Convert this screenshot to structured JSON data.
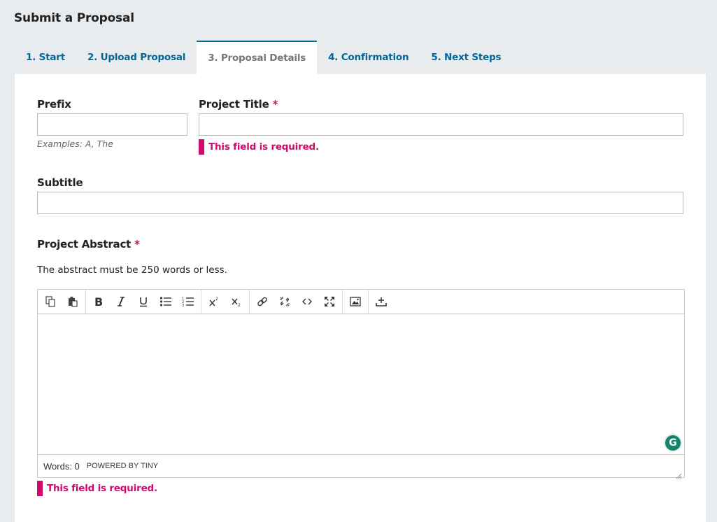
{
  "page": {
    "title": "Submit a Proposal"
  },
  "tabs": [
    {
      "label": "1. Start",
      "active": false
    },
    {
      "label": "2. Upload Proposal",
      "active": false
    },
    {
      "label": "3. Proposal Details",
      "active": true
    },
    {
      "label": "4. Confirmation",
      "active": false
    },
    {
      "label": "5. Next Steps",
      "active": false
    }
  ],
  "form": {
    "prefix": {
      "label": "Prefix",
      "value": "",
      "hint": "Examples: A, The"
    },
    "project_title": {
      "label": "Project Title",
      "required_mark": "*",
      "value": "",
      "error": "This field is required."
    },
    "subtitle": {
      "label": "Subtitle",
      "value": ""
    },
    "abstract": {
      "label": "Project Abstract",
      "required_mark": "*",
      "description": "The abstract must be 250 words or less.",
      "value": "",
      "error": "This field is required.",
      "editor": {
        "toolbar": [
          [
            "copy-icon",
            "paste-icon"
          ],
          [
            "bold-icon",
            "italic-icon",
            "underline-icon",
            "bullet-list-icon",
            "numbered-list-icon"
          ],
          [
            "superscript-icon",
            "subscript-icon"
          ],
          [
            "link-icon",
            "unlink-icon",
            "code-icon",
            "fullscreen-icon"
          ],
          [
            "image-icon"
          ],
          [
            "upload-icon"
          ]
        ],
        "word_count": "Words: 0",
        "powered_by": "POWERED BY TINY",
        "grammarly_label": "G"
      }
    }
  },
  "colors": {
    "accent": "#006798",
    "error": "#d00a6c",
    "background": "#e9ecee",
    "grammarly": "#15836e"
  }
}
